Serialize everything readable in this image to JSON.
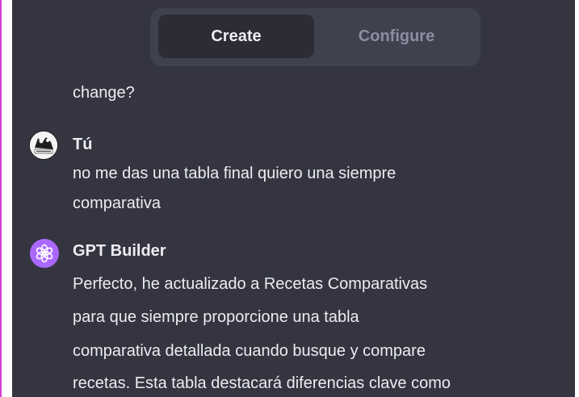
{
  "tabs": {
    "create": "Create",
    "configure": "Configure"
  },
  "messages": [
    {
      "author": "",
      "lines": [
        "change?"
      ]
    },
    {
      "author": "Tú",
      "avatar_icon": "user-avatar-icon",
      "lines": [
        "no me das una tabla final quiero una siempre",
        "comparativa"
      ]
    },
    {
      "author": "GPT Builder",
      "avatar_icon": "openai-logo-icon",
      "lines": [
        "Perfecto, he actualizado a Recetas Comparativas",
        "para que siempre proporcione una tabla",
        "comparativa detallada cuando busque y compare",
        "recetas. Esta tabla destacará diferencias clave como"
      ]
    }
  ],
  "colors": {
    "background": "#343541",
    "tab_bar": "#40414f",
    "active_tab": "#2b2c36",
    "text": "#ececf1",
    "muted_text": "#8e8ea0",
    "gpt_avatar": "#ab68ff",
    "left_edge": "#d63bd6"
  }
}
